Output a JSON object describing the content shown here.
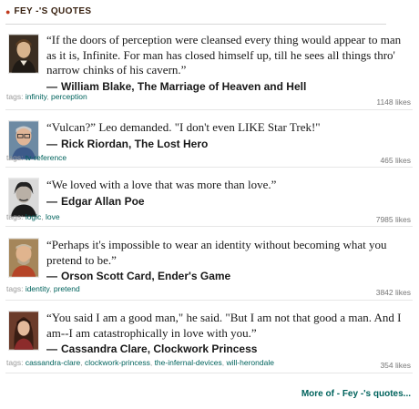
{
  "header": {
    "title": "FEY -'S QUOTES"
  },
  "quotes": [
    {
      "text": "“If the doors of perception were cleansed every thing would appear to man as it is, Infinite. For man has closed himself up, till he sees all things thro' narrow chinks of his cavern.”",
      "author": "William Blake, The Marriage of Heaven and Hell",
      "tags_label": "tags:",
      "tags": [
        "infinity",
        "perception"
      ],
      "likes": "1148 likes",
      "avatar_icon": "william-blake-portrait"
    },
    {
      "text": "“Vulcan?” Leo demanded. \"I don't even LIKE Star Trek!\"",
      "author": "Rick Riordan, The Lost Hero",
      "tags_label": "tags:",
      "tags": [
        "tv-reference"
      ],
      "likes": "465 likes",
      "avatar_icon": "rick-riordan-portrait"
    },
    {
      "text": "“We loved with a love that was more than love.”",
      "author": "Edgar Allan Poe",
      "tags_label": "tags:",
      "tags": [
        "logic",
        "love"
      ],
      "likes": "7985 likes",
      "avatar_icon": "edgar-allan-poe-portrait"
    },
    {
      "text": "“Perhaps it's impossible to wear an identity without becoming what you pretend to be.”",
      "author": "Orson Scott Card, Ender's Game",
      "tags_label": "tags:",
      "tags": [
        "identity",
        "pretend"
      ],
      "likes": "3842 likes",
      "avatar_icon": "orson-scott-card-portrait"
    },
    {
      "text": "“You said I am a good man,\" he said. \"But I am not that good a man. And I am--I am catastrophically in love with you.”",
      "author": "Cassandra Clare, Clockwork Princess",
      "tags_label": "tags:",
      "tags": [
        "cassandra-clare",
        "clockwork-princess",
        "the-infernal-devices",
        "will-herondale"
      ],
      "likes": "354 likes",
      "avatar_icon": "cassandra-clare-portrait"
    }
  ],
  "author_dash": "—",
  "more_link": "More of - Fey -'s quotes..."
}
